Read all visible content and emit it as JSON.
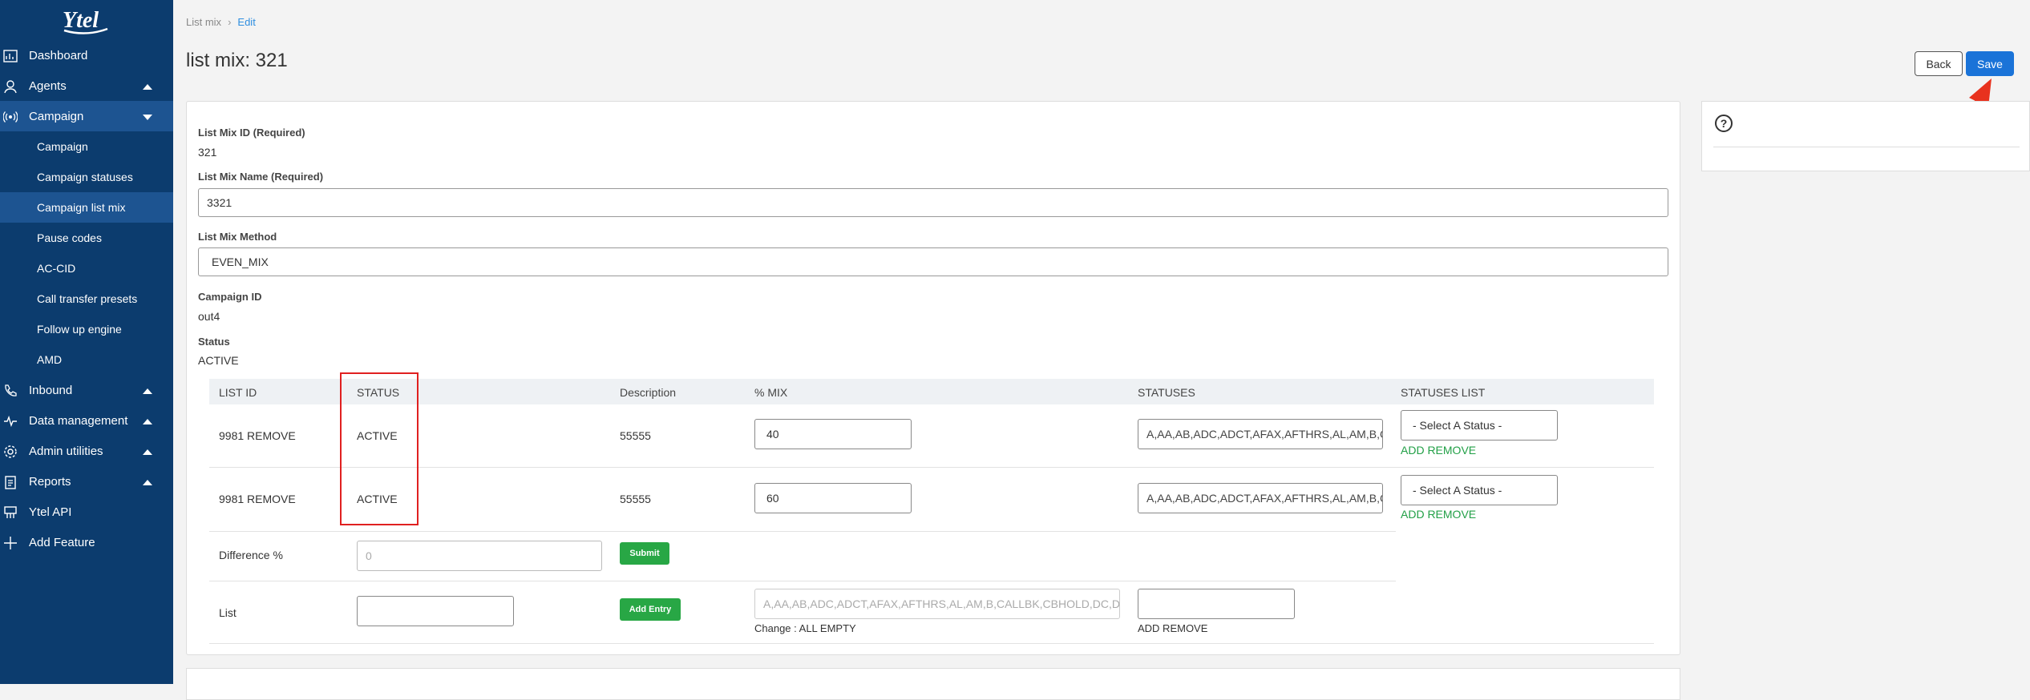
{
  "sidebar": {
    "logo": "Ytel",
    "items": [
      {
        "label": "Dashboard",
        "icon": "dashboard-icon"
      },
      {
        "label": "Agents",
        "icon": "agents-icon",
        "caret": "up"
      },
      {
        "label": "Campaign",
        "icon": "campaign-icon",
        "caret": "down"
      },
      {
        "label": "Inbound",
        "icon": "phone-icon",
        "caret": "up"
      },
      {
        "label": "Data management",
        "icon": "pulse-icon",
        "caret": "up"
      },
      {
        "label": "Admin utilities",
        "icon": "gear-icon",
        "caret": "up"
      },
      {
        "label": "Reports",
        "icon": "clipboard-icon",
        "caret": "up"
      },
      {
        "label": "Ytel API",
        "icon": "api-icon"
      },
      {
        "label": "Add Feature",
        "icon": "plus-icon"
      }
    ],
    "sub_items": [
      "Campaign",
      "Campaign statuses",
      "Campaign list mix",
      "Pause codes",
      "AC-CID",
      "Call transfer presets",
      "Follow up engine",
      "AMD"
    ]
  },
  "breadcrumb": {
    "parent": "List mix",
    "current": "Edit"
  },
  "page_title": "list mix: 321",
  "buttons": {
    "back": "Back",
    "save": "Save"
  },
  "form": {
    "id_label": "List Mix ID (Required)",
    "id_value": "321",
    "name_label": "List Mix Name (Required)",
    "name_value": "3321",
    "method_label": "List Mix Method",
    "method_value": "EVEN_MIX",
    "campaign_label": "Campaign ID",
    "campaign_value": "out4",
    "status_label": "Status",
    "status_value": "ACTIVE"
  },
  "table": {
    "headers": [
      "LIST ID",
      "STATUS",
      "Description",
      "% MIX",
      "STATUSES",
      "STATUSES LIST"
    ],
    "rows": [
      {
        "list_id": "9981 REMOVE",
        "status": "ACTIVE",
        "description": "55555",
        "mix": "40",
        "statuses": "A,AA,AB,ADC,ADCT,AFAX,AFTHRS,AL,AM,B,C",
        "select": "- Select A Status -",
        "action": "ADD REMOVE"
      },
      {
        "list_id": "9981 REMOVE",
        "status": "ACTIVE",
        "description": "55555",
        "mix": "60",
        "statuses": "A,AA,AB,ADC,ADCT,AFAX,AFTHRS,AL,AM,B,C",
        "select": "- Select A Status -",
        "action": "ADD REMOVE"
      }
    ],
    "difference_label": "Difference %",
    "difference_placeholder": "0",
    "submit_label": "Submit",
    "list_label": "List",
    "add_entry_label": "Add Entry",
    "list_statuses_placeholder": "A,AA,AB,ADC,ADCT,AFAX,AFTHRS,AL,AM,B,CALLBK,CBHOLD,DC,DE",
    "change_text": "Change : ALL EMPTY",
    "list_action": "ADD REMOVE"
  },
  "colors": {
    "sidebar": "#0c3c6e",
    "active": "#1d5491",
    "accent": "#1a73d8",
    "green": "#28a745",
    "highlight": "#e02020"
  }
}
